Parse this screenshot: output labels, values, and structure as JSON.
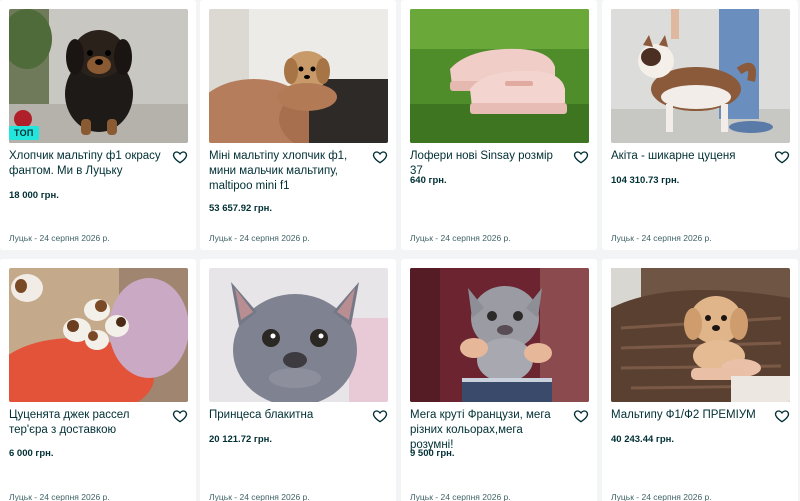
{
  "listings": [
    {
      "title": "Хлопчик мальтіпу ф1 окрасу фантом. Ми в Луцьку",
      "price": "18 000 грн.",
      "location_date": "Луцьк - 24 серпня 2026 р.",
      "badge": "ТОП",
      "icon": "heart-outline-icon"
    },
    {
      "title": "Міні мальтіпу хлопчик ф1, мини мальчик мальтипу, maltipoo mini f1",
      "price": "53 657.92 грн.",
      "location_date": "Луцьк - 24 серпня 2026 р.",
      "icon": "heart-outline-icon"
    },
    {
      "title": "Лофери нові Sinsay розмір 37",
      "price": "640 грн.",
      "location_date": "Луцьк - 24 серпня 2026 р.",
      "icon": "heart-outline-icon"
    },
    {
      "title": "Акіта - шикарне цуценя",
      "price": "104 310.73 грн.",
      "location_date": "Луцьк - 24 серпня 2026 р.",
      "icon": "heart-outline-icon"
    },
    {
      "title": "Цуценята джек рассел тер'єра з доставкою",
      "price": "6 000 грн.",
      "location_date": "Луцьк - 24 серпня 2026 р.",
      "icon": "heart-outline-icon"
    },
    {
      "title": "Принцеса блакитна",
      "price": "20 121.72 грн.",
      "location_date": "Луцьк - 24 серпня 2026 р.",
      "icon": "heart-outline-icon"
    },
    {
      "title": "Мега круті Французи, мега різних кольорах,мега розумні!",
      "price": "9 500 грн.",
      "location_date": "Луцьк - 24 серпня 2026 р.",
      "icon": "heart-outline-icon"
    },
    {
      "title": "Мальтипу Ф1/Ф2 ПРЕМІУМ",
      "price": "40 243.44 грн.",
      "location_date": "Луцьк - 24 серпня 2026 р.",
      "icon": "heart-outline-icon"
    }
  ],
  "colors": {
    "page_bg": "#f2f4f5",
    "card_bg": "#ffffff",
    "text": "#002f34",
    "meta_text": "#406367",
    "badge_bg": "#23e5db"
  }
}
